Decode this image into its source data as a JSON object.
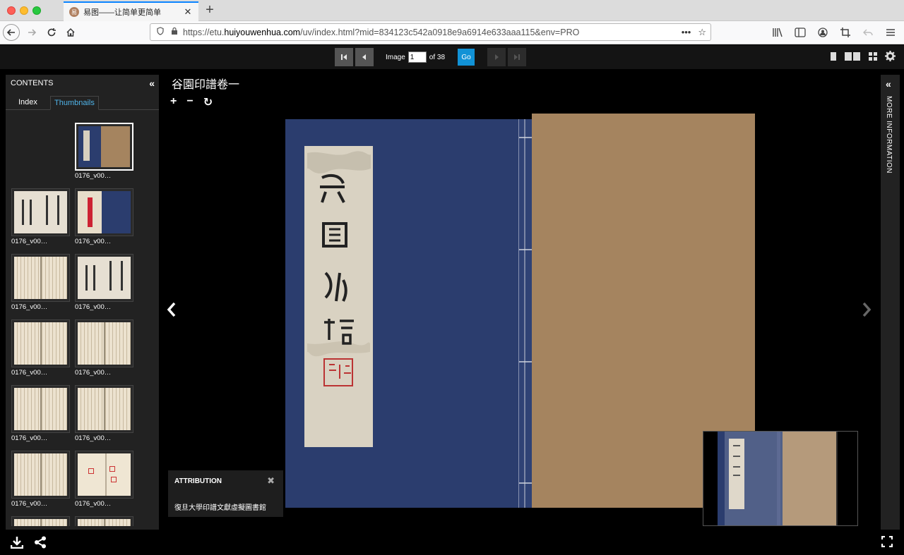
{
  "browser": {
    "tab_title": "易图——让简单更简单",
    "new_tab": "+",
    "tab_close": "✕",
    "url_prefix": "https://etu.",
    "url_domain": "huiyouwenhua.com",
    "url_suffix": "/uv/index.html?mid=834123c542a0918e9a6914e633aaa115&env=PRO",
    "url_more": "•••",
    "url_star": "☆"
  },
  "viewer": {
    "pager": {
      "image_label": "Image",
      "current_page": "1",
      "of_label": "of 38",
      "go_label": "Go"
    },
    "contents_title": "CONTENTS",
    "tabs": {
      "index": "Index",
      "thumbnails": "Thumbnails"
    },
    "thumbnails": [
      {
        "label": "0176_v00…",
        "type": "cover",
        "selected": true
      },
      {
        "label": "0176_v00…",
        "type": "title"
      },
      {
        "label": "0176_v00…",
        "type": "cover-open"
      },
      {
        "label": "0176_v00…",
        "type": "text"
      },
      {
        "label": "0176_v00…",
        "type": "title"
      },
      {
        "label": "0176_v00…",
        "type": "text"
      },
      {
        "label": "0176_v00…",
        "type": "text"
      },
      {
        "label": "0176_v00…",
        "type": "text"
      },
      {
        "label": "0176_v00…",
        "type": "text"
      },
      {
        "label": "0176_v00…",
        "type": "text"
      },
      {
        "label": "0176_v00…",
        "type": "seals"
      },
      {
        "label": "",
        "type": "text"
      },
      {
        "label": "",
        "type": "text"
      }
    ],
    "title": "谷園印譜卷一",
    "zoom": {
      "in": "+",
      "out": "−",
      "rotate": "↻"
    },
    "attribution": {
      "title": "ATTRIBUTION",
      "text": "復旦大學印譜文獻虛擬圖書館"
    },
    "more_information": "MORE INFORMATION"
  },
  "colors": {
    "accent": "#1192d6",
    "tab_active": "#4fb3e8",
    "cover_blue": "#2b3d6e",
    "cover_brown": "#a5845f"
  }
}
